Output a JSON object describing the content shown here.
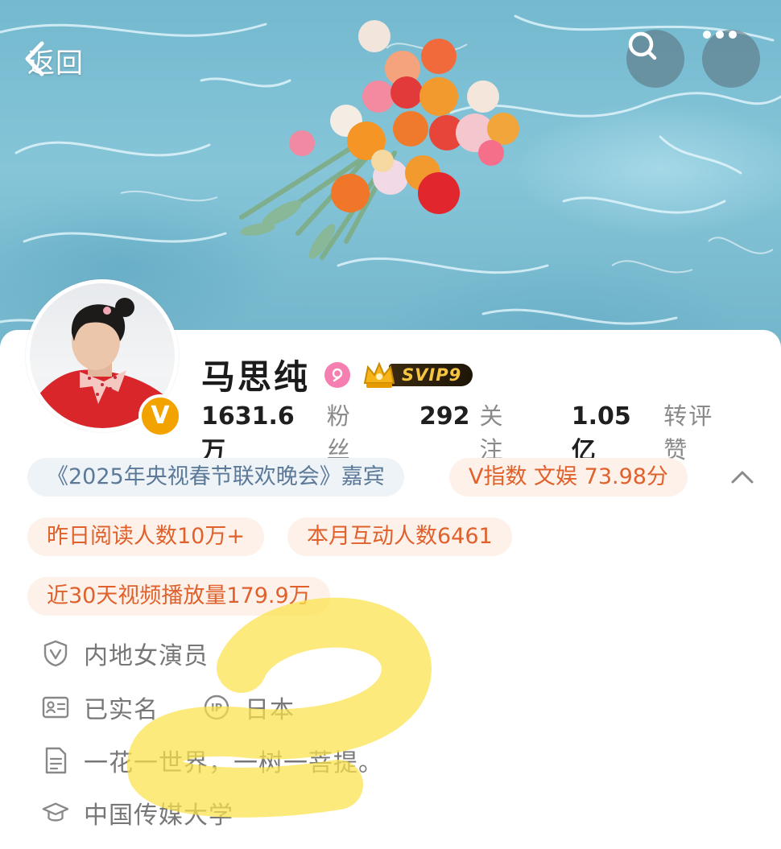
{
  "header": {
    "back_label": "返回",
    "back_icon": "chevron-left-icon",
    "search_icon": "search-icon",
    "more_icon": "more-dots-icon"
  },
  "profile": {
    "name": "马思纯",
    "gender_icon": "female-icon",
    "vip_badge": "SVIP9",
    "verified_badge": "V",
    "stats": [
      {
        "value": "1631.6万",
        "label": "粉丝"
      },
      {
        "value": "292",
        "label": "关注"
      },
      {
        "value": "1.05亿",
        "label": "转评赞"
      }
    ]
  },
  "tags": {
    "guest": "《2025年央视春节联欢晚会》嘉宾",
    "v_index": "V指数 文娱 73.98分",
    "reads_yesterday": "昨日阅读人数10万+",
    "monthly_interactions": "本月互动人数6461",
    "video_plays": "近30天视频播放量179.9万"
  },
  "info": {
    "occupation": "内地女演员",
    "real_name": "已实名",
    "ip_location": "日本",
    "bio": "一花一世界，一树一菩提。",
    "school": "中国传媒大学"
  },
  "colors": {
    "accent_orange": "#e0612b",
    "tag_orange_bg": "#fdf1ea",
    "tag_blue_bg": "#eef3f8",
    "tag_blue_text": "#5c7a98",
    "verified": "#f3a300",
    "highlighter": "#fbe24a"
  }
}
